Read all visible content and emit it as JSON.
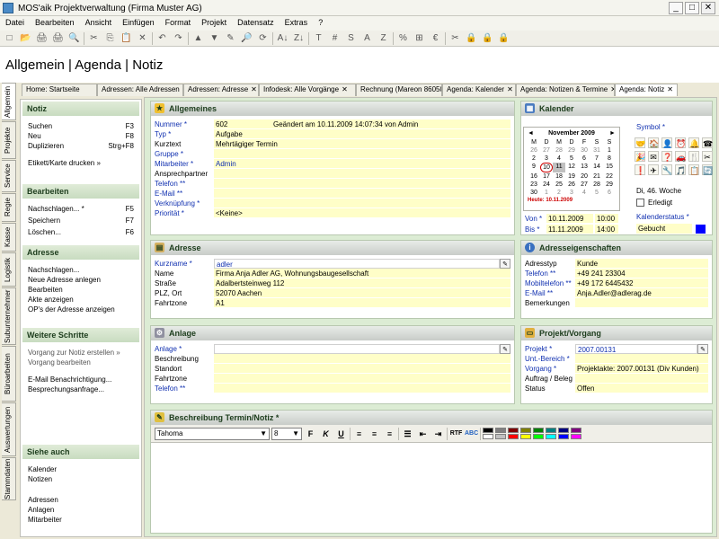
{
  "window": {
    "title": "MOS'aik Projektverwaltung (Firma Muster AG)",
    "min": "_",
    "max": "□",
    "close": "✕"
  },
  "menu": [
    "Datei",
    "Bearbeiten",
    "Ansicht",
    "Einfügen",
    "Format",
    "Projekt",
    "Datensatz",
    "Extras",
    "?"
  ],
  "toolbar_icons": [
    "new-icon",
    "open-icon",
    "print-icon",
    "print-preview-icon",
    "preview-icon",
    "cut-icon",
    "copy-icon",
    "paste-icon",
    "delete-icon",
    "undo-icon",
    "redo-icon",
    "up-icon",
    "down-icon",
    "edit-icon",
    "search-icon",
    "refresh-icon",
    "sort-asc-icon",
    "sort-desc-icon",
    "t-icon",
    "hash-icon",
    "s-icon",
    "a-icon",
    "z-icon",
    "percent-icon",
    "calc-icon",
    "euro-icon",
    "tools-icon",
    "lock-blue-icon",
    "lock-yellow-icon",
    "lock-red-icon"
  ],
  "toolbar_glyphs": [
    "□",
    "📂",
    "🖨",
    "🖨",
    "🔍",
    "✂",
    "⎘",
    "📋",
    "✕",
    "↶",
    "↷",
    "▲",
    "▼",
    "✎",
    "🔎",
    "⟳",
    "A↓",
    "Z↓",
    "T",
    "#",
    "S",
    "A",
    "Z",
    "%",
    "⊞",
    "€",
    "✂",
    "🔒",
    "🔒",
    "🔒"
  ],
  "header": {
    "title": "Allgemein | Agenda | Notiz"
  },
  "vtabs": [
    "Allgemein",
    "Projekte",
    "Service",
    "Regie",
    "Kasse",
    "Logistik",
    "Subunternehmer",
    "Büroarbeiten",
    "Auswertungen",
    "Stammdaten"
  ],
  "tabs": [
    "Home: Startseite",
    "Adressen: Alle Adressen",
    "Adressen: Adresse",
    "Infodesk: Alle Vorgänge",
    "Rechnung (Mareon 86050)",
    "Agenda: Kalender",
    "Agenda: Notizen & Termine",
    "Agenda: Notiz"
  ],
  "tab_close": "✕",
  "sidebar": {
    "notiz": {
      "title": "Notiz",
      "items": [
        {
          "label": "Suchen",
          "key": "F3"
        },
        {
          "label": "Neu",
          "key": "F8"
        },
        {
          "label": "Duplizieren",
          "key": "Strg+F8"
        }
      ],
      "extra": "Etikett/Karte drucken »"
    },
    "bearbeiten": {
      "title": "Bearbeiten",
      "items": [
        {
          "label": "Nachschlagen... *",
          "key": "F5"
        },
        {
          "label": "Speichern",
          "key": "F7"
        },
        {
          "label": "Löschen...",
          "key": "F6"
        }
      ]
    },
    "adresse": {
      "title": "Adresse",
      "items": [
        "Nachschlagen...",
        "Neue Adresse anlegen",
        "Bearbeiten",
        "Akte anzeigen",
        "OP's der Adresse anzeigen"
      ]
    },
    "weitere": {
      "title": "Weitere Schritte",
      "items": [
        "Vorgang zur Notiz erstellen »",
        "Vorgang bearbeiten",
        "E-Mail Benachrichtigung...",
        "Besprechungsanfrage..."
      ]
    },
    "siehe": {
      "title": "Siehe auch",
      "items": [
        "Kalender",
        "Notizen",
        "Adressen",
        "Anlagen",
        "Mitarbeiter"
      ]
    }
  },
  "allgemeines": {
    "title": "Allgemeines",
    "rows": [
      {
        "label": "Nummer *",
        "value": "602",
        "extra": "Geändert am 10.11.2009 14:07:34 von Admin",
        "blue": true
      },
      {
        "label": "Typ *",
        "value": "Aufgabe",
        "blue": true
      },
      {
        "label": "Kurztext",
        "value": "Mehrtägiger Termin",
        "blue": false
      },
      {
        "label": "Gruppe *",
        "value": "",
        "blue": true
      },
      {
        "label": "Mitarbeiter *",
        "value": "Admin",
        "blue": true
      },
      {
        "label": "Ansprechpartner",
        "value": "",
        "blue": false
      },
      {
        "label": "Telefon **",
        "value": "",
        "blue": true
      },
      {
        "label": "E-Mail **",
        "value": "",
        "blue": true
      },
      {
        "label": "Verknüpfung *",
        "value": "",
        "blue": true
      },
      {
        "label": "Priorität *",
        "value": "<Keine>",
        "blue": true
      }
    ]
  },
  "kalender": {
    "title": "Kalender",
    "month": "November 2009",
    "prev": "◄",
    "next": "►",
    "weekdays": [
      "M",
      "D",
      "M",
      "D",
      "F",
      "S",
      "S"
    ],
    "days": [
      [
        "26",
        "27",
        "28",
        "29",
        "30",
        "31",
        "1"
      ],
      [
        "2",
        "3",
        "4",
        "5",
        "6",
        "7",
        "8"
      ],
      [
        "9",
        "10",
        "11",
        "12",
        "13",
        "14",
        "15"
      ],
      [
        "16",
        "17",
        "18",
        "19",
        "20",
        "21",
        "22"
      ],
      [
        "23",
        "24",
        "25",
        "26",
        "27",
        "28",
        "29"
      ],
      [
        "30",
        "1",
        "2",
        "3",
        "4",
        "5",
        "6"
      ]
    ],
    "today": "Heute: 10.11.2009",
    "symbol_label": "Symbol *",
    "icons": [
      "🤝",
      "🏠",
      "👤",
      "⏰",
      "🔔",
      "☎",
      "🎉",
      "✉",
      "❓",
      "🚗",
      "🍴",
      "✂",
      "❗",
      "✈",
      "🔧",
      "🎵",
      "📋",
      "🔄"
    ],
    "week": "Di, 46. Woche",
    "erledigt": "Erledigt",
    "von_label": "Von *",
    "von_date": "10.11.2009",
    "von_time": "10:00",
    "bis_label": "Bis *",
    "bis_date": "11.11.2009",
    "bis_time": "14:00",
    "status_label": "Kalenderstatus *",
    "status_value": "Gebucht",
    "status_color": "#0000ff"
  },
  "adresse": {
    "title": "Adresse",
    "rows": [
      {
        "label": "Kurzname *",
        "value": "adler",
        "blue": true
      },
      {
        "label": "Name",
        "value": "Firma Anja Adler AG, Wohnungsbaugesellschaft",
        "blue": false
      },
      {
        "label": "Straße",
        "value": "Adalbertsteinweg 112",
        "blue": false
      },
      {
        "label": "PLZ, Ort",
        "value": "52070 Aachen",
        "blue": false
      },
      {
        "label": "Fahrtzone",
        "value": "A1",
        "blue": false
      }
    ]
  },
  "adresseig": {
    "title": "Adresseigenschaften",
    "rows": [
      {
        "label": "Adresstyp",
        "value": "Kunde",
        "blue": false
      },
      {
        "label": "Telefon **",
        "value": "+49 241 23304",
        "blue": true
      },
      {
        "label": "Mobiltelefon **",
        "value": "+49 172 6445432",
        "blue": true
      },
      {
        "label": "E-Mail **",
        "value": "Anja.Adler@adlerag.de",
        "blue": true
      },
      {
        "label": "Bemerkungen",
        "value": "",
        "blue": false
      }
    ]
  },
  "anlage": {
    "title": "Anlage",
    "rows": [
      {
        "label": "Anlage *",
        "value": "",
        "blue": true
      },
      {
        "label": "Beschreibung",
        "value": "",
        "blue": false
      },
      {
        "label": "Standort",
        "value": "",
        "blue": false
      },
      {
        "label": "Fahrtzone",
        "value": "",
        "blue": false
      },
      {
        "label": "Telefon **",
        "value": "",
        "blue": true
      }
    ]
  },
  "projekt": {
    "title": "Projekt/Vorgang",
    "rows": [
      {
        "label": "Projekt *",
        "value": "2007.00131",
        "blue": true
      },
      {
        "label": "Unt.-Bereich *",
        "value": "",
        "blue": true
      },
      {
        "label": "Vorgang *",
        "value": "Projektakte: 2007.00131 (Div Kunden)",
        "blue": true
      },
      {
        "label": "Auftrag / Beleg",
        "value": "",
        "blue": false
      },
      {
        "label": "Status",
        "value": "Offen",
        "blue": false
      }
    ]
  },
  "beschreibung": {
    "title": "Beschreibung Termin/Notiz *",
    "font": "Tahoma",
    "size": "8",
    "format_buttons": [
      "F",
      "K",
      "U"
    ],
    "colors": [
      "#000000",
      "#808080",
      "#800000",
      "#808000",
      "#008000",
      "#008080",
      "#000080",
      "#800080",
      "#ffffff",
      "#c0c0c0",
      "#ff0000",
      "#ffff00",
      "#00ff00",
      "#00ffff",
      "#0000ff",
      "#ff00ff"
    ]
  },
  "colors": {
    "panel_header": "#c8ccc8",
    "field_yellow": "#fffec8",
    "label_blue": "#1030b0",
    "main_bg": "#dcecd4"
  }
}
